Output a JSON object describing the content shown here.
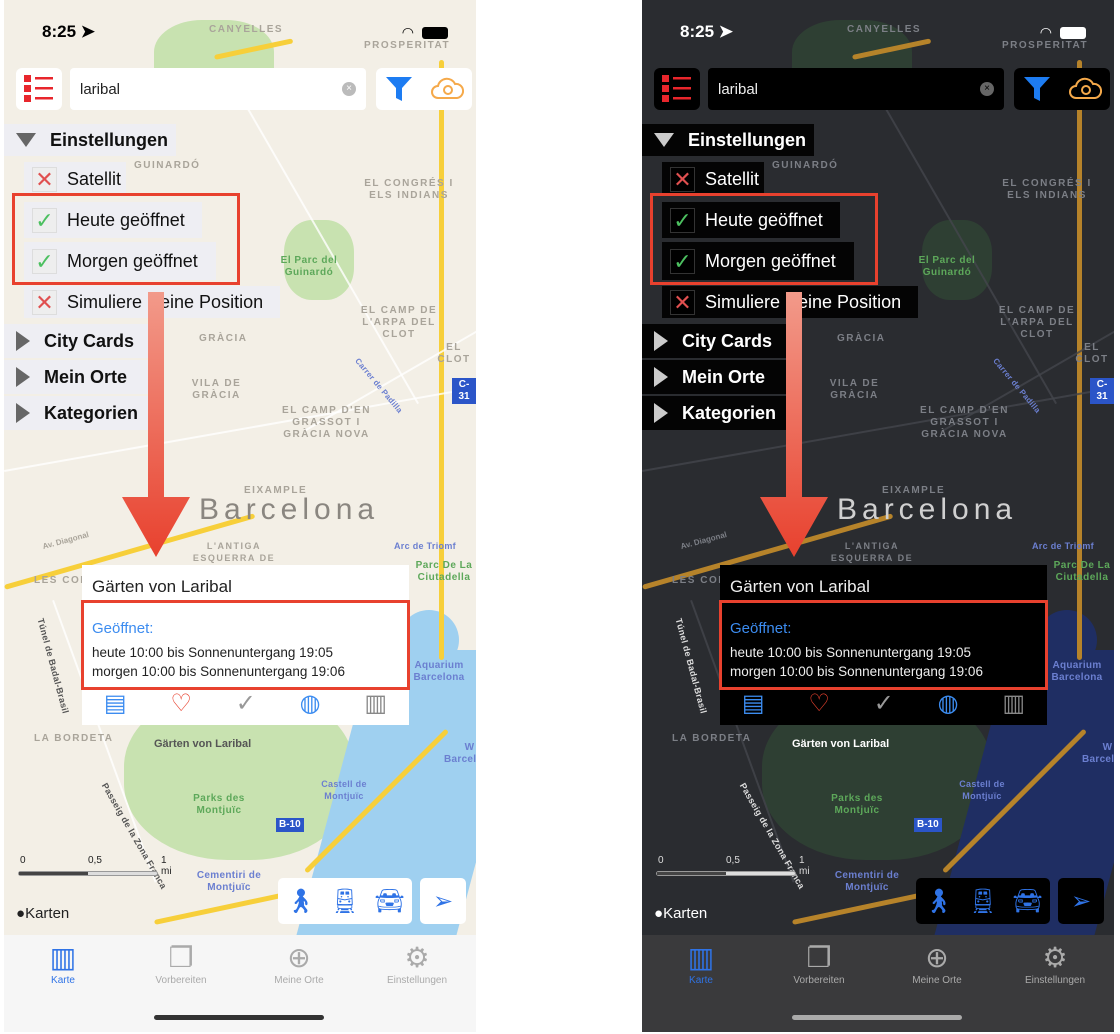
{
  "phones": [
    {
      "theme": "light"
    },
    {
      "theme": "dark"
    }
  ],
  "status": {
    "time": "8:25",
    "location_icon": "location-arrow-icon",
    "wifi_icon": "wifi-icon",
    "battery_icon": "battery-icon"
  },
  "toolbar": {
    "list_icon": "checklist-icon",
    "search_value": "laribal",
    "filter_icon": "filter-icon",
    "cloud_icon": "cloud-search-icon"
  },
  "menu": {
    "settings_header": "Einstellungen",
    "options": [
      {
        "label": "Satellit",
        "checked": false
      },
      {
        "label": "Heute geöffnet",
        "checked": true
      },
      {
        "label": "Morgen geöffnet",
        "checked": true
      },
      {
        "label": "Simuliere Deine Position",
        "checked": false
      }
    ],
    "sections": [
      "City Cards",
      "Mein Orte",
      "Kategorien"
    ]
  },
  "map": {
    "city": "Barcelona",
    "labels": [
      "CANYELLES",
      "PROSPERITAT",
      "GUINARDÓ",
      "EL CONGRÉS I ELS INDIANS",
      "El Parc del Guinardó",
      "EL CAMP DE L'ARPA DEL CLOT",
      "EL CLOT",
      "GRÀCIA",
      "VILA DE GRÀCIA",
      "EL CAMP D'EN GRASSOT I GRÀCIA NOVA",
      "Carrer de Padilla",
      "EIXAMPLE",
      "L'ANTIGA ESQUERRA DE L'EIXAMPLE",
      "Av. Diagonal",
      "LES CORTS",
      "Arc de Triomf",
      "Parc De La Ciutadella",
      "Túnel de Badal-Brasil",
      "LA BORDETA",
      "Aquarium Barcelona",
      "Parks des Montjuïc",
      "Castell de Montjuïc",
      "B-10",
      "Cementiri de Montjuïc",
      "Passeig de la Zona Franca",
      "W Barcelona",
      "C-31"
    ],
    "pin_label": "Gärten von Laribal",
    "scale": [
      "0",
      "0,5",
      "1 mi"
    ],
    "scale_fraction": 0.5,
    "attribution": "Karten"
  },
  "callout": {
    "title": "Gärten von Laribal",
    "open_label": "Geöffnet:",
    "today": "heute 10:00 bis Sonnenuntergang 19:05",
    "tomorrow": "morgen 10:00 bis Sonnenuntergang 19:06",
    "icons": [
      "document-icon",
      "heart-icon",
      "checkmark-icon",
      "globe-icon",
      "map-icon"
    ]
  },
  "transport": [
    "walk-icon",
    "transit-icon",
    "car-icon"
  ],
  "locate_icon": "navigation-arrow-icon",
  "tabs": [
    {
      "label": "Karte",
      "icon": "map-icon",
      "active": true
    },
    {
      "label": "Vorbereiten",
      "icon": "copy-icon",
      "active": false
    },
    {
      "label": "Meine Orte",
      "icon": "pin-add-icon",
      "active": false
    },
    {
      "label": "Einstellungen",
      "icon": "gear-icon",
      "active": false
    }
  ],
  "colors": {
    "accent": "#2f73e6",
    "highlight": "#e8412e",
    "open_text": "#3c8cf0",
    "checked": "#4cc060",
    "unchecked": "#e05050"
  }
}
